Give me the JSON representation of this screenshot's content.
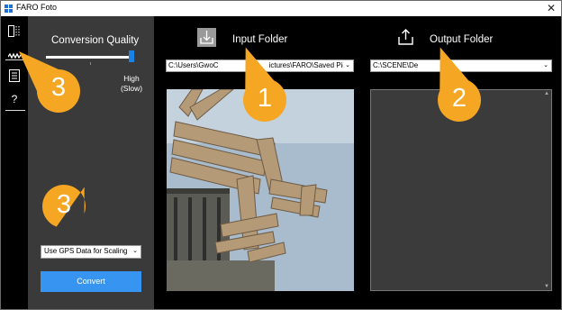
{
  "window": {
    "title": "FARO Foto",
    "close_glyph": "✕"
  },
  "rail": {
    "icons": [
      "compare-panels-icon",
      "scan-wave-icon",
      "document-icon"
    ],
    "help_label": "?"
  },
  "settings": {
    "conversion_quality_label": "Conversion Quality",
    "slider": {
      "level": 1.0,
      "max_label_line1": "High",
      "max_label_line2": "(Slow)"
    },
    "gps_option": "Use GPS Data for Scaling",
    "convert_label": "Convert"
  },
  "input": {
    "label": "Input Folder",
    "path_left": "C:\\Users\\GwoC",
    "path_right": "ictures\\FARO\\Saved Pic"
  },
  "output": {
    "label": "Output Folder",
    "path": "C:\\SCENE\\De"
  },
  "callouts": [
    {
      "number": "3",
      "color": "#f5a623"
    },
    {
      "number": "1",
      "color": "#f5a623"
    },
    {
      "number": "2",
      "color": "#f5a623"
    },
    {
      "number": "3",
      "color": "#f5a623"
    }
  ],
  "colors": {
    "accent": "#3794f0",
    "callout": "#f5a623",
    "panel": "#3a3a3a"
  }
}
